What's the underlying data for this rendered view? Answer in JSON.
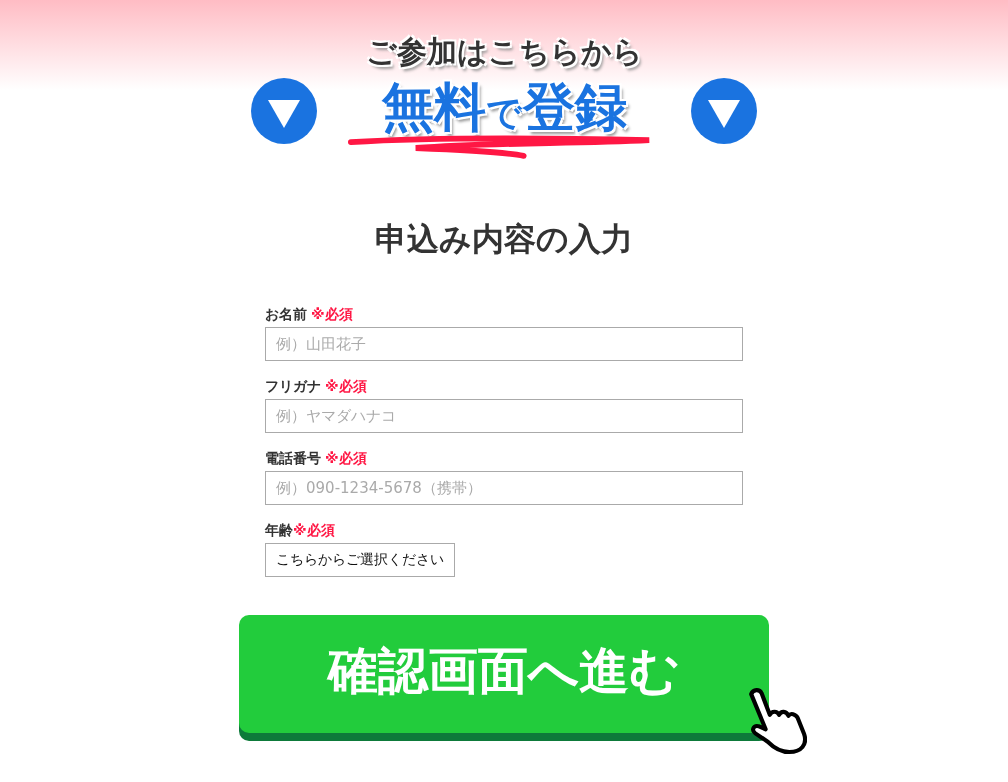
{
  "banner": {
    "subtitle": "ご参加はこちらから",
    "headline": [
      {
        "text": "無料",
        "kind": "large"
      },
      {
        "text": "で",
        "kind": "small"
      },
      {
        "text": "登録",
        "kind": "large"
      }
    ]
  },
  "form": {
    "title": "申込み内容の入力",
    "fields": [
      {
        "label": "お名前",
        "required": "※必須",
        "kind": "text",
        "placeholder": "例）山田花子"
      },
      {
        "label": "フリガナ",
        "required": "※必須",
        "kind": "text",
        "placeholder": "例）ヤマダハナコ"
      },
      {
        "label": "電話番号",
        "required": "※必須",
        "kind": "text",
        "placeholder": "例）090-1234-5678（携帯）"
      },
      {
        "label": "年齢",
        "required": "※必須",
        "kind": "select",
        "value": "こちらからご選択ください"
      }
    ],
    "submit": "確認画面へ進む"
  }
}
